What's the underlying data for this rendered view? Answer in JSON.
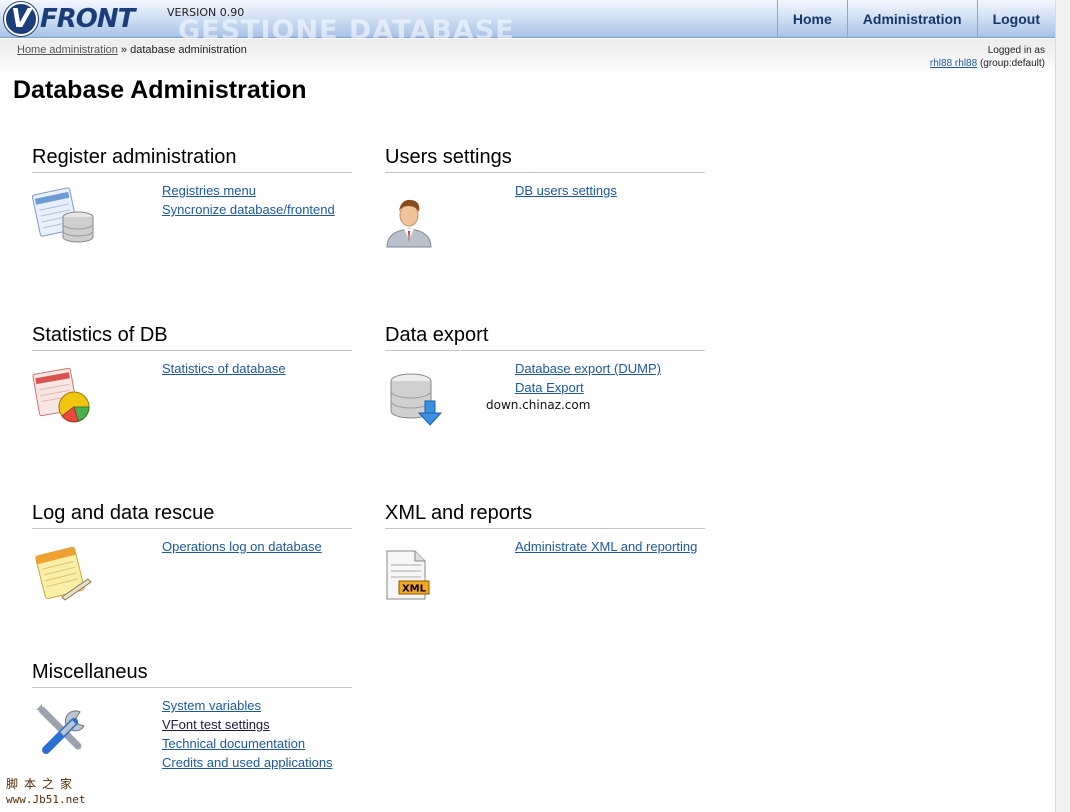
{
  "header": {
    "logo_letter": "V",
    "logo_text": "FRONT",
    "version": "VERSION 0.90",
    "watermark_title": "GESTIONE DATABASE",
    "nav": [
      "Home",
      "Administration",
      "Logout"
    ]
  },
  "breadcrumb": {
    "home_link": "Home administration",
    "separator": " » ",
    "current": "database administration"
  },
  "login": {
    "line1": "Logged in as",
    "user_link": "rhl88 rhl88",
    "group": " (group:default)"
  },
  "page_title": "Database Administration",
  "sections": [
    {
      "title": "Register administration",
      "icon": "registry-database-icon",
      "links": [
        "Registries menu",
        "Syncronize database/frontend"
      ]
    },
    {
      "title": "Users settings",
      "icon": "user-icon",
      "links": [
        "DB users settings"
      ]
    },
    {
      "title": "Statistics of DB",
      "icon": "pie-chart-icon",
      "links": [
        "Statistics of database"
      ]
    },
    {
      "title": "Data export",
      "icon": "database-export-icon",
      "links": [
        "Database export (DUMP)",
        "Data Export"
      ]
    },
    {
      "title": "Log and data rescue",
      "icon": "notepad-log-icon",
      "links": [
        "Operations log on database"
      ]
    },
    {
      "title": "XML and reports",
      "icon": "xml-document-icon",
      "links": [
        "Administrate XML and reporting"
      ]
    },
    {
      "title": "Miscellaneus",
      "icon": "tools-icon",
      "links": [
        "System variables",
        "VFont test settings",
        "Technical documentation",
        "Credits and used applications"
      ]
    }
  ],
  "overlay_watermark": "down.chinaz.com",
  "corner_watermark": {
    "line1": "脚本之家",
    "line2": "www.Jb51.net"
  },
  "colors": {
    "link": "#1a5aa0",
    "nav_text": "#17356e",
    "header_gradient_bottom": "#a8c3e6"
  }
}
